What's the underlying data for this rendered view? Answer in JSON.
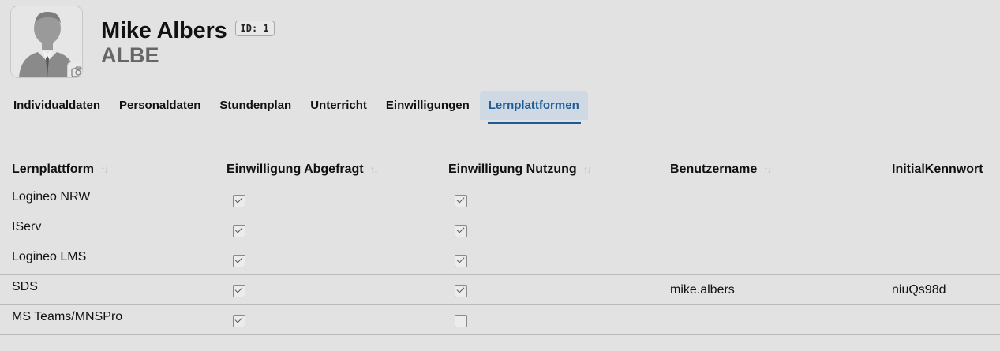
{
  "person": {
    "name": "Mike Albers",
    "id_label": "ID: 1",
    "kuerzel": "ALBE"
  },
  "tabs": [
    {
      "label": "Individualdaten",
      "active": false
    },
    {
      "label": "Personaldaten",
      "active": false
    },
    {
      "label": "Stundenplan",
      "active": false
    },
    {
      "label": "Unterricht",
      "active": false
    },
    {
      "label": "Einwilligungen",
      "active": false
    },
    {
      "label": "Lernplattformen",
      "active": true
    }
  ],
  "table": {
    "columns": [
      "Lernplattform",
      "Einwilligung Abgefragt",
      "Einwilligung Nutzung",
      "Benutzername",
      "InitialKennwort"
    ],
    "rows": [
      {
        "platform": "Logineo NRW",
        "abgefragt": true,
        "nutzung": true,
        "username": "",
        "password": ""
      },
      {
        "platform": "IServ",
        "abgefragt": true,
        "nutzung": true,
        "username": "",
        "password": ""
      },
      {
        "platform": "Logineo LMS",
        "abgefragt": true,
        "nutzung": true,
        "username": "",
        "password": ""
      },
      {
        "platform": "SDS",
        "abgefragt": true,
        "nutzung": true,
        "username": "mike.albers",
        "password": "niuQs98d"
      },
      {
        "platform": "MS Teams/MNSPro",
        "abgefragt": true,
        "nutzung": false,
        "username": "",
        "password": ""
      }
    ]
  },
  "icons": {
    "avatar": "person-silhouette-icon",
    "camera": "camera-icon",
    "sort": "sort-arrows-icon"
  }
}
